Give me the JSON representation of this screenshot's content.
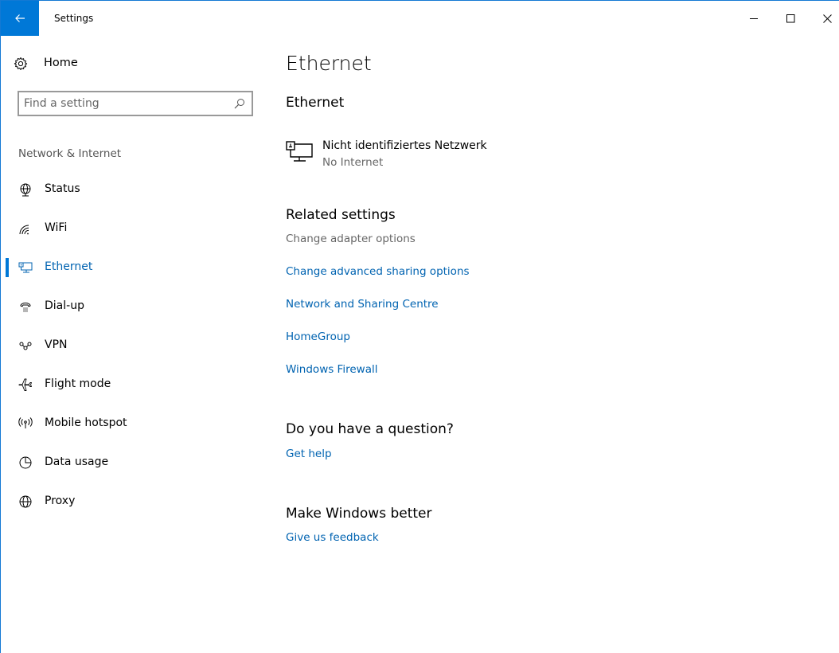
{
  "window": {
    "title": "Settings",
    "controls": {
      "minimize": "minimize",
      "maximize": "maximize",
      "close": "close"
    }
  },
  "sidebar": {
    "home_label": "Home",
    "search": {
      "placeholder": "Find a setting",
      "value": ""
    },
    "section_label": "Network & Internet",
    "items": [
      {
        "label": "Status",
        "icon": "status-globe-icon",
        "active": false
      },
      {
        "label": "WiFi",
        "icon": "wifi-icon",
        "active": false
      },
      {
        "label": "Ethernet",
        "icon": "ethernet-icon",
        "active": true
      },
      {
        "label": "Dial-up",
        "icon": "dialup-icon",
        "active": false
      },
      {
        "label": "VPN",
        "icon": "vpn-icon",
        "active": false
      },
      {
        "label": "Flight mode",
        "icon": "airplane-icon",
        "active": false
      },
      {
        "label": "Mobile hotspot",
        "icon": "hotspot-icon",
        "active": false
      },
      {
        "label": "Data usage",
        "icon": "data-usage-icon",
        "active": false
      },
      {
        "label": "Proxy",
        "icon": "proxy-globe-icon",
        "active": false
      }
    ]
  },
  "main": {
    "page_title": "Ethernet",
    "section_title": "Ethernet",
    "network": {
      "name": "Nicht identifiziertes Netzwerk",
      "status": "No Internet"
    },
    "related": {
      "title": "Related settings",
      "adapter_options": "Change adapter options",
      "links": [
        "Change advanced sharing options",
        "Network and Sharing Centre",
        "HomeGroup",
        "Windows Firewall"
      ]
    },
    "question": {
      "title": "Do you have a question?",
      "link": "Get help"
    },
    "feedback": {
      "title": "Make Windows better",
      "link": "Give us feedback"
    }
  },
  "colors": {
    "accent": "#0078d7",
    "link": "#0063b1",
    "muted": "#666666"
  }
}
